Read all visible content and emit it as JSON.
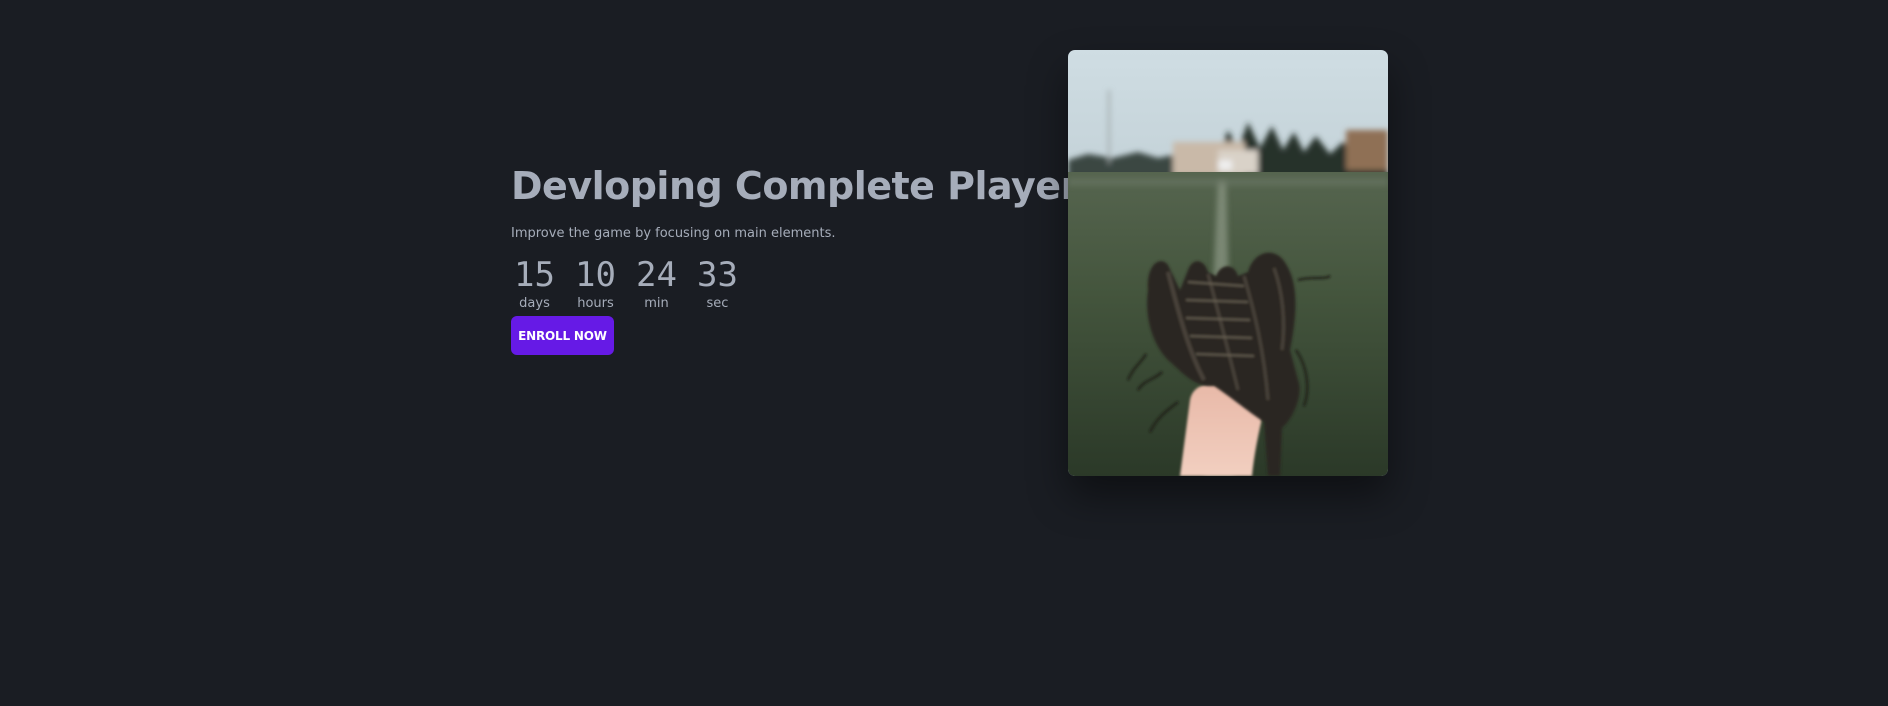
{
  "hero": {
    "title": "Devloping Complete Players!",
    "subtitle": "Improve the game by focusing on main elements.",
    "enroll_label": "ENROLL NOW",
    "image_alt": "baseball glove on a field"
  },
  "countdown": [
    {
      "value": "15",
      "label": "days"
    },
    {
      "value": "10",
      "label": "hours"
    },
    {
      "value": "24",
      "label": "min"
    },
    {
      "value": "33",
      "label": "sec"
    }
  ],
  "colors": {
    "background": "#1a1d23",
    "text": "#a6adba",
    "accent": "#661ae6"
  }
}
